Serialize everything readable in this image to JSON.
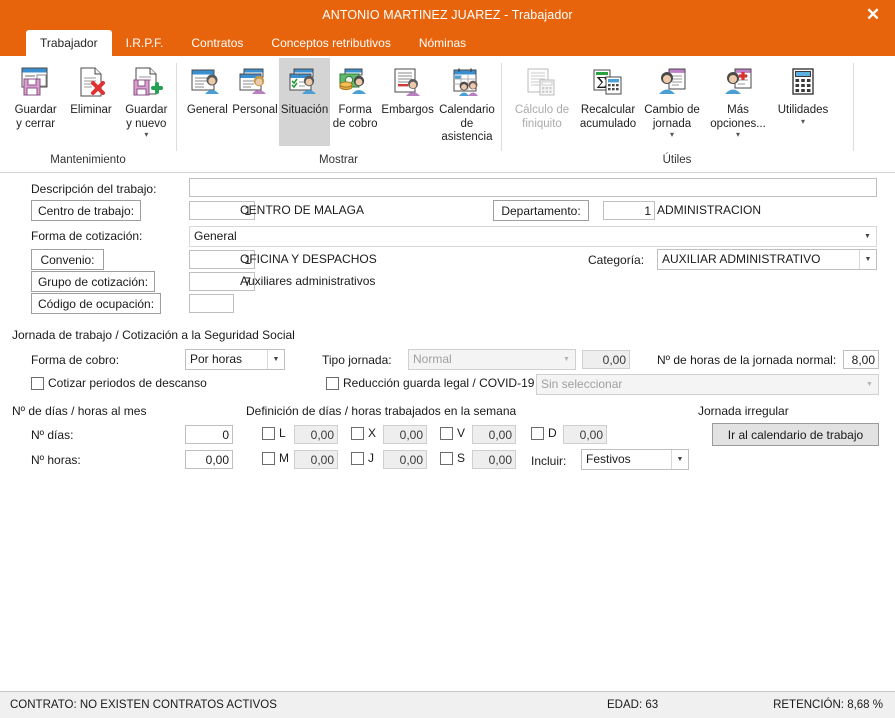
{
  "window": {
    "title": "ANTONIO MARTINEZ JUAREZ - Trabajador",
    "close_label": "✕",
    "accent_color": "#e8640c"
  },
  "tabs": [
    {
      "label": "Trabajador",
      "active": true
    },
    {
      "label": "I.R.P.F.",
      "active": false
    },
    {
      "label": "Contratos",
      "active": false
    },
    {
      "label": "Conceptos retributivos",
      "active": false
    },
    {
      "label": "Nóminas",
      "active": false
    }
  ],
  "ribbon": {
    "groups": [
      {
        "name": "Mantenimiento",
        "label": "Mantenimiento",
        "items": [
          {
            "label": "Guardar\ny cerrar",
            "icon": "save-close-icon",
            "state": "normal",
            "dropdown": false
          },
          {
            "label": "Eliminar",
            "icon": "delete-document-icon",
            "state": "normal",
            "dropdown": false
          },
          {
            "label": "Guardar\ny nuevo",
            "icon": "save-new-icon",
            "state": "normal",
            "dropdown": true
          }
        ]
      },
      {
        "name": "Mostrar",
        "label": "Mostrar",
        "items": [
          {
            "label": "General",
            "icon": "person-card-icon",
            "state": "normal",
            "dropdown": false
          },
          {
            "label": "Personal",
            "icon": "person-cards-icon",
            "state": "normal",
            "dropdown": false
          },
          {
            "label": "Situación",
            "icon": "person-check-icon",
            "state": "selected",
            "dropdown": false
          },
          {
            "label": "Forma\nde cobro",
            "icon": "money-person-icon",
            "state": "normal",
            "dropdown": false
          },
          {
            "label": "Embargos",
            "icon": "document-person-icon",
            "state": "normal",
            "dropdown": false
          },
          {
            "label": "Calendario\nde asistencia",
            "icon": "calendar-people-icon",
            "state": "normal",
            "dropdown": false
          }
        ]
      },
      {
        "name": "Utiles",
        "label": "Útiles",
        "items": [
          {
            "label": "Cálculo de\nfiniquito",
            "icon": "calculator-document-icon",
            "state": "disabled",
            "dropdown": false
          },
          {
            "label": "Recalcular\nacumulado",
            "icon": "sigma-calculator-icon",
            "state": "normal",
            "dropdown": false
          },
          {
            "label": "Cambio de\njornada",
            "icon": "person-list-icon",
            "state": "normal",
            "dropdown": true
          },
          {
            "label": "Más\nopciones...",
            "icon": "person-plus-icon",
            "state": "normal",
            "dropdown": true
          },
          {
            "label": "Utilidades",
            "icon": "calculator-icon",
            "state": "normal",
            "dropdown": true
          }
        ]
      }
    ]
  },
  "form": {
    "descripcion_label": "Descripción del trabajo:",
    "descripcion_value": "",
    "centro_button": "Centro de trabajo:",
    "centro_code": "1",
    "centro_name": "CENTRO DE MALAGA",
    "departamento_button": "Departamento:",
    "departamento_code": "1",
    "departamento_name": "ADMINISTRACION",
    "forma_cotizacion_label": "Forma de cotización:",
    "forma_cotizacion_value": "General",
    "convenio_button": "Convenio:",
    "convenio_code": "1",
    "convenio_name": "OFICINA Y DESPACHOS",
    "categoria_label": "Categoría:",
    "categoria_value": "AUXILIAR ADMINISTRATIVO",
    "grupo_button": "Grupo de cotización:",
    "grupo_code": "7",
    "grupo_name": "Auxiliares administrativos",
    "ocupacion_button": "Código de ocupación:",
    "ocupacion_code": "",
    "jornada_section": "Jornada de trabajo / Cotización a la Seguridad Social",
    "forma_cobro_label": "Forma de cobro:",
    "forma_cobro_value": "Por horas",
    "cotizar_descanso_label": "Cotizar periodos de descanso",
    "cotizar_descanso_checked": false,
    "tipo_jornada_label": "Tipo jornada:",
    "tipo_jornada_value": "Normal",
    "tipo_jornada_num": "0,00",
    "horas_jornada_label": "Nº de horas de la jornada normal:",
    "horas_jornada_value": "8,00",
    "reduccion_label": "Reducción guarda legal / COVID-19",
    "reduccion_checked": false,
    "reduccion_select_value": "Sin seleccionar",
    "dias_mes_section": "Nº de días / horas al mes",
    "num_dias_label": "Nº días:",
    "num_dias_value": "0",
    "num_horas_label": "Nº horas:",
    "num_horas_value": "0,00",
    "definicion_section": "Definición de días / horas trabajados en la semana",
    "week": [
      {
        "key": "L",
        "value": "0,00",
        "checked": false
      },
      {
        "key": "M",
        "value": "0,00",
        "checked": false
      },
      {
        "key": "X",
        "value": "0,00",
        "checked": false
      },
      {
        "key": "J",
        "value": "0,00",
        "checked": false
      },
      {
        "key": "V",
        "value": "0,00",
        "checked": false
      },
      {
        "key": "S",
        "value": "0,00",
        "checked": false
      },
      {
        "key": "D",
        "value": "0,00",
        "checked": false
      }
    ],
    "incluir_label": "Incluir:",
    "incluir_value": "Festivos",
    "jornada_irregular_section": "Jornada irregular",
    "calendario_button": "Ir al calendario de trabajo"
  },
  "status": {
    "contrato": "CONTRATO: NO EXISTEN CONTRATOS ACTIVOS",
    "edad": "EDAD: 63",
    "retencion": "RETENCIÓN: 8,68 %"
  }
}
